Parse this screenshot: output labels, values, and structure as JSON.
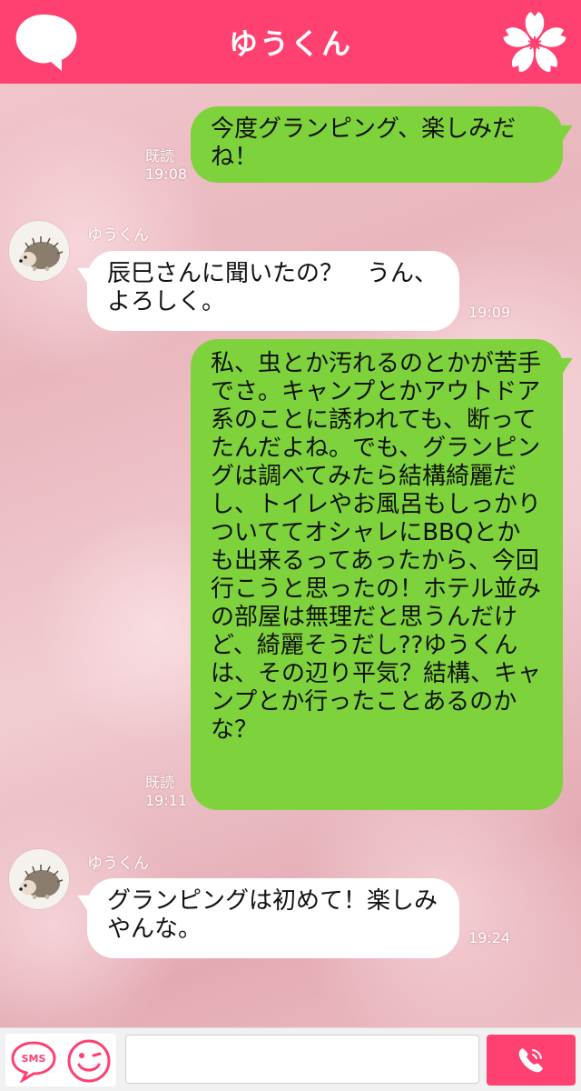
{
  "header": {
    "title": "ゆうくん",
    "left_icon": "speech-cloud-icon",
    "right_icon": "sakura-flower-icon",
    "color": "#ff4171"
  },
  "messages": [
    {
      "direction": "out",
      "text": "今度グランピング、楽しみだね！",
      "read_label": "既読",
      "time": "19:08"
    },
    {
      "direction": "in",
      "sender": "ゆうくん",
      "text": "辰巳さんに聞いたの？　うん、よろしく。",
      "time": "19:09"
    },
    {
      "direction": "out",
      "text": "私、虫とか汚れるのとかが苦手でさ。キャンプとかアウトドア系のことに誘われても、断ってたんだよね。でも、グランピングは調べてみたら結構綺麗だし、トイレやお風呂もしっかりついててオシャレにBBQとかも出来るってあったから、今回行こうと思ったの！ホテル並みの部屋は無理だと思うんだけど、綺麗そうだし??ゆうくんは、その辺り平気？結構、キャンプとか行ったことあるのかな？",
      "read_label": "既読",
      "time": "19:11"
    },
    {
      "direction": "in",
      "sender": "ゆうくん",
      "text": "グランピングは初めて！楽しみやんな。",
      "time": "19:24"
    }
  ],
  "footer": {
    "sms_label": "SMS",
    "emoji_icon": "smiley-wink-icon",
    "input_placeholder": "",
    "call_icon": "phone-icon"
  },
  "colors": {
    "outgoing_bubble": "#7ed23b",
    "incoming_bubble": "#ffffff",
    "accent": "#ff4171"
  }
}
